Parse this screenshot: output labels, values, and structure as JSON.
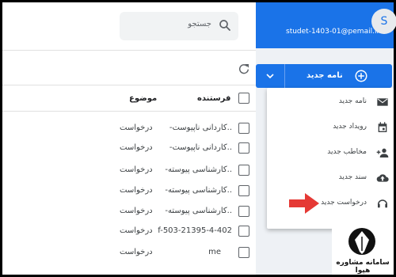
{
  "search": {
    "placeholder": "جستجو"
  },
  "list": {
    "columns": {
      "sender": "فرستنده",
      "subject": "موضوع"
    },
    "rows": [
      {
        "sender": "-کاردانی ناپیوست..",
        "subject": "درخواست"
      },
      {
        "sender": "-کاردانی ناپیوست..",
        "subject": "درخواست"
      },
      {
        "sender": "-کارشناسی پیوسته..",
        "subject": "درخواست"
      },
      {
        "sender": "-کارشناسی پیوسته..",
        "subject": "درخواست"
      },
      {
        "sender": "-کارشناسی پیوسته..",
        "subject": "درخواست"
      },
      {
        "sender": "f-503-21395-4-402",
        "subject": "درخواست"
      },
      {
        "sender": "me",
        "subject": "درخواست"
      }
    ]
  },
  "account": {
    "email": "studet-1403-01@pemail.ir",
    "avatar_letter": "S"
  },
  "compose": {
    "label": "نامه جدید"
  },
  "menu": {
    "items": [
      {
        "label": "نامه جدید",
        "icon": "mail-icon"
      },
      {
        "label": "رویداد جدید",
        "icon": "calendar-icon"
      },
      {
        "label": "مخاطب جدید",
        "icon": "add-contact-icon"
      },
      {
        "label": "سند جدید",
        "icon": "upload-icon"
      },
      {
        "label": "درخواست جدید",
        "icon": "support-icon"
      }
    ]
  },
  "logo": {
    "text": "سامانه مشاوره هپوا"
  },
  "colors": {
    "accent": "#1a73e8",
    "arrow": "#e53935"
  }
}
